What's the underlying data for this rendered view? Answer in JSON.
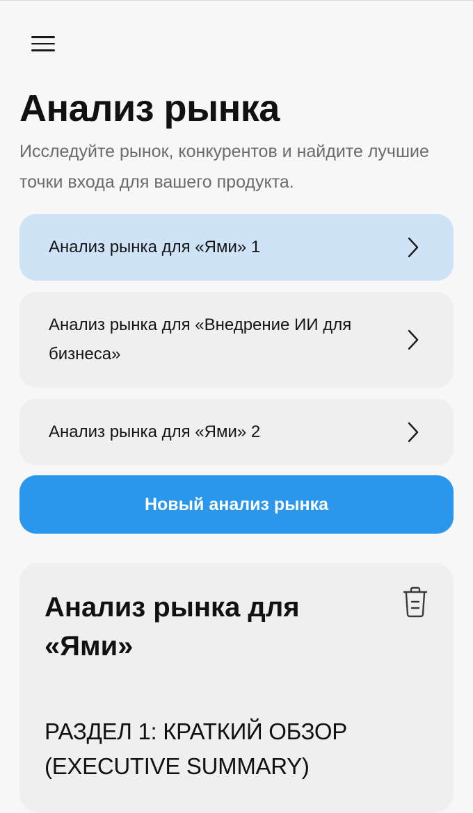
{
  "header": {
    "menu_icon": "hamburger-menu-icon"
  },
  "page": {
    "title": "Анализ рынка",
    "subtitle": "Исследуйте рынок, конкурентов и найдите лучшие точки входа для вашего продукта."
  },
  "analyses": [
    {
      "label": "Анализ рынка для «Ями» 1",
      "selected": true,
      "icon": "chevron-right-icon"
    },
    {
      "label": "Анализ рынка для «Внедрение ИИ для бизнеса»",
      "selected": false,
      "icon": "chevron-right-icon"
    },
    {
      "label": "Анализ рынка для «Ями» 2",
      "selected": false,
      "icon": "chevron-right-icon"
    }
  ],
  "actions": {
    "new_analysis_label": "Новый анализ рынка"
  },
  "detail": {
    "title": "Анализ рынка для «Ями»",
    "delete_icon": "trash-icon",
    "section_heading": "РАЗДЕЛ 1: КРАТКИЙ ОБЗОР (EXECUTIVE SUMMARY)"
  },
  "colors": {
    "background": "#f7f7f7",
    "card": "#efefef",
    "card_selected": "#cfe3f7",
    "accent": "#2a97ec",
    "subtitle_text": "#6b6b6b"
  }
}
